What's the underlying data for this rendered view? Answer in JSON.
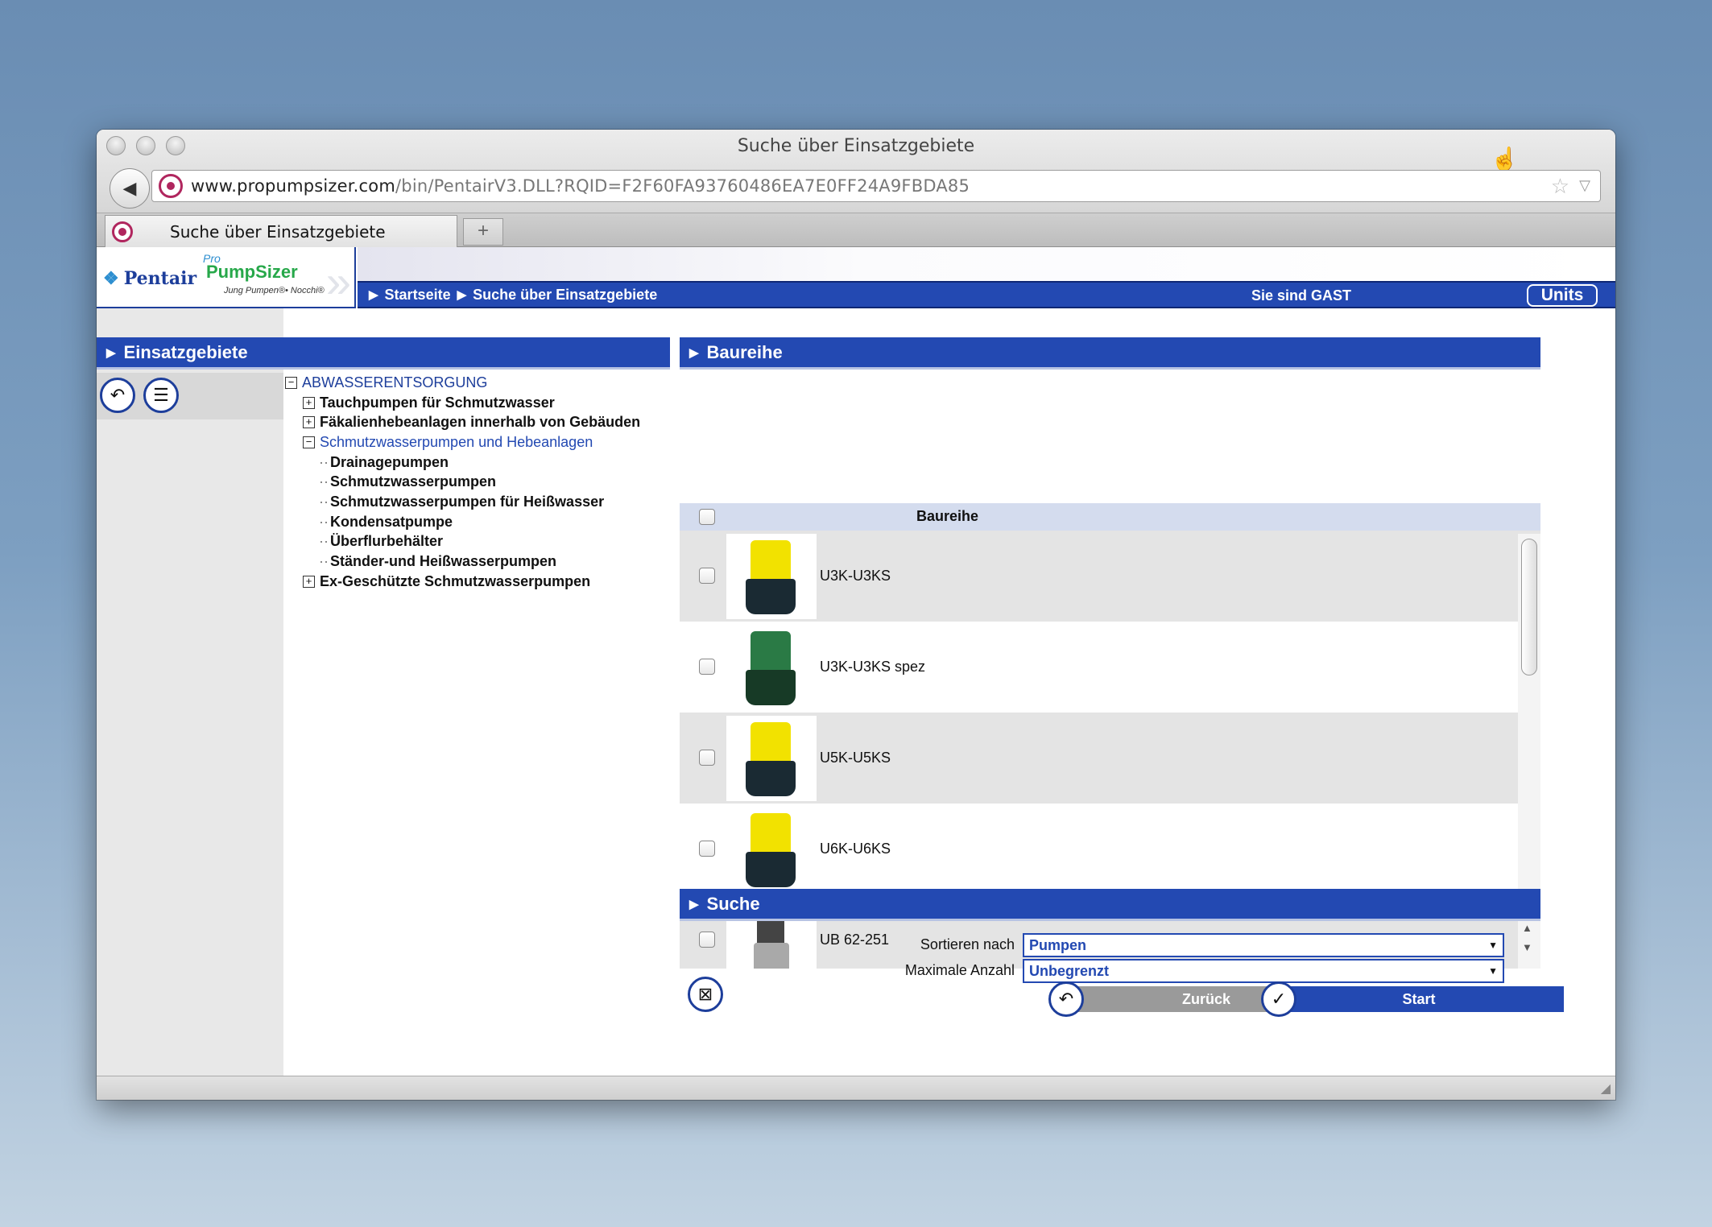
{
  "window": {
    "title": "Suche über Einsatzgebiete"
  },
  "address": {
    "host": "www.propumpsizer.com",
    "path": "/bin/PentairV3.DLL?RQID=F2F60FA93760486EA7E0FF24A9FBDA85"
  },
  "tab": {
    "label": "Suche über Einsatzgebiete",
    "new_tab": "+"
  },
  "logo": {
    "brand": "Pentair",
    "pro": "Pro",
    "product": "PumpSizer",
    "tagline": "Jung Pumpen®• Nocchi®"
  },
  "nav": {
    "crumbs": [
      "Startseite",
      "Suche über Einsatzgebiete"
    ],
    "guest": "Sie sind GAST",
    "units": "Units"
  },
  "left": {
    "title": "Einsatzgebiete",
    "tree": {
      "root": "ABWASSERENTSORGUNG",
      "items": [
        {
          "label": "Tauchpumpen für Schmutzwasser",
          "toggle": "+"
        },
        {
          "label": "Fäkalienhebeanlagen innerhalb von Gebäuden",
          "toggle": "+"
        },
        {
          "label": "Schmutzwasserpumpen und Hebeanlagen",
          "toggle": "−"
        },
        {
          "label": "Ex-Geschützte Schmutzwasserpumpen",
          "toggle": "+"
        }
      ],
      "children": [
        "Drainagepumpen",
        "Schmutzwasserpumpen",
        "Schmutzwasserpumpen für Heißwasser",
        "Kondensatpumpe",
        "Überflurbehälter",
        "Ständer-und Heißwasserpumpen"
      ],
      "root_toggle": "−"
    }
  },
  "series": {
    "title": "Baureihe",
    "column": "Baureihe",
    "rows": [
      "U3K-U3KS",
      "U3K-U3KS spez",
      "U5K-U5KS",
      "U6K-U6KS",
      "UB 62-251"
    ]
  },
  "search": {
    "title": "Suche",
    "sort_label": "Sortieren nach",
    "sort_value": "Pumpen",
    "max_label": "Maximale Anzahl",
    "max_value": "Unbegrenzt",
    "back_label": "Zurück",
    "start_label": "Start"
  },
  "colors": {
    "nav_blue": "#2349b2",
    "dark_blue": "#1d3e9b",
    "accent_green": "#27a84a"
  }
}
